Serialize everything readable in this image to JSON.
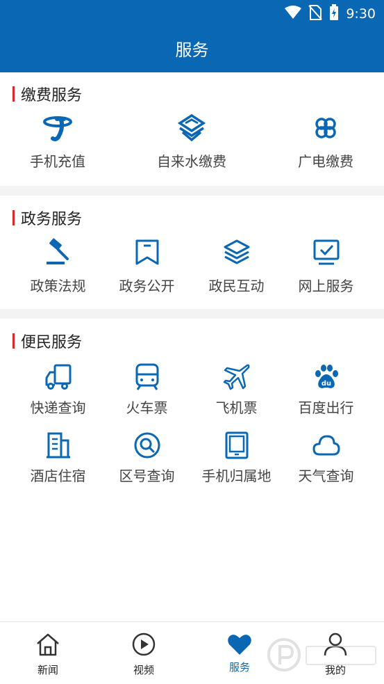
{
  "status": {
    "time": "9:30"
  },
  "header": {
    "title": "服务"
  },
  "sections": [
    {
      "title": "缴费服务",
      "items": [
        {
          "label": "手机充值",
          "icon": "china-telecom-icon"
        },
        {
          "label": "自来水缴费",
          "icon": "china-mobile-icon"
        },
        {
          "label": "广电缴费",
          "icon": "china-unicom-icon"
        }
      ]
    },
    {
      "title": "政务服务",
      "items": [
        {
          "label": "政策法规",
          "icon": "gavel-icon"
        },
        {
          "label": "政务公开",
          "icon": "bookmark-icon"
        },
        {
          "label": "政民互动",
          "icon": "layers-icon"
        },
        {
          "label": "网上服务",
          "icon": "monitor-check-icon"
        }
      ]
    },
    {
      "title": "便民服务",
      "items": [
        {
          "label": "快递查询",
          "icon": "truck-icon"
        },
        {
          "label": "火车票",
          "icon": "train-icon"
        },
        {
          "label": "飞机票",
          "icon": "airplane-icon"
        },
        {
          "label": "百度出行",
          "icon": "baidu-icon"
        },
        {
          "label": "酒店住宿",
          "icon": "building-icon"
        },
        {
          "label": "区号查询",
          "icon": "search-circle-icon"
        },
        {
          "label": "手机归属地",
          "icon": "tablet-icon"
        },
        {
          "label": "天气查询",
          "icon": "cloud-icon"
        }
      ]
    }
  ],
  "tabs": [
    {
      "label": "新闻",
      "icon": "home-icon",
      "active": false
    },
    {
      "label": "视频",
      "icon": "play-circle-icon",
      "active": false
    },
    {
      "label": "服务",
      "icon": "heart-icon",
      "active": true
    },
    {
      "label": "我的",
      "icon": "user-icon",
      "active": false
    }
  ],
  "colors": {
    "primary": "#0a67b3",
    "accent_bar": "#d8282a",
    "divider": "#f3f3f3"
  }
}
